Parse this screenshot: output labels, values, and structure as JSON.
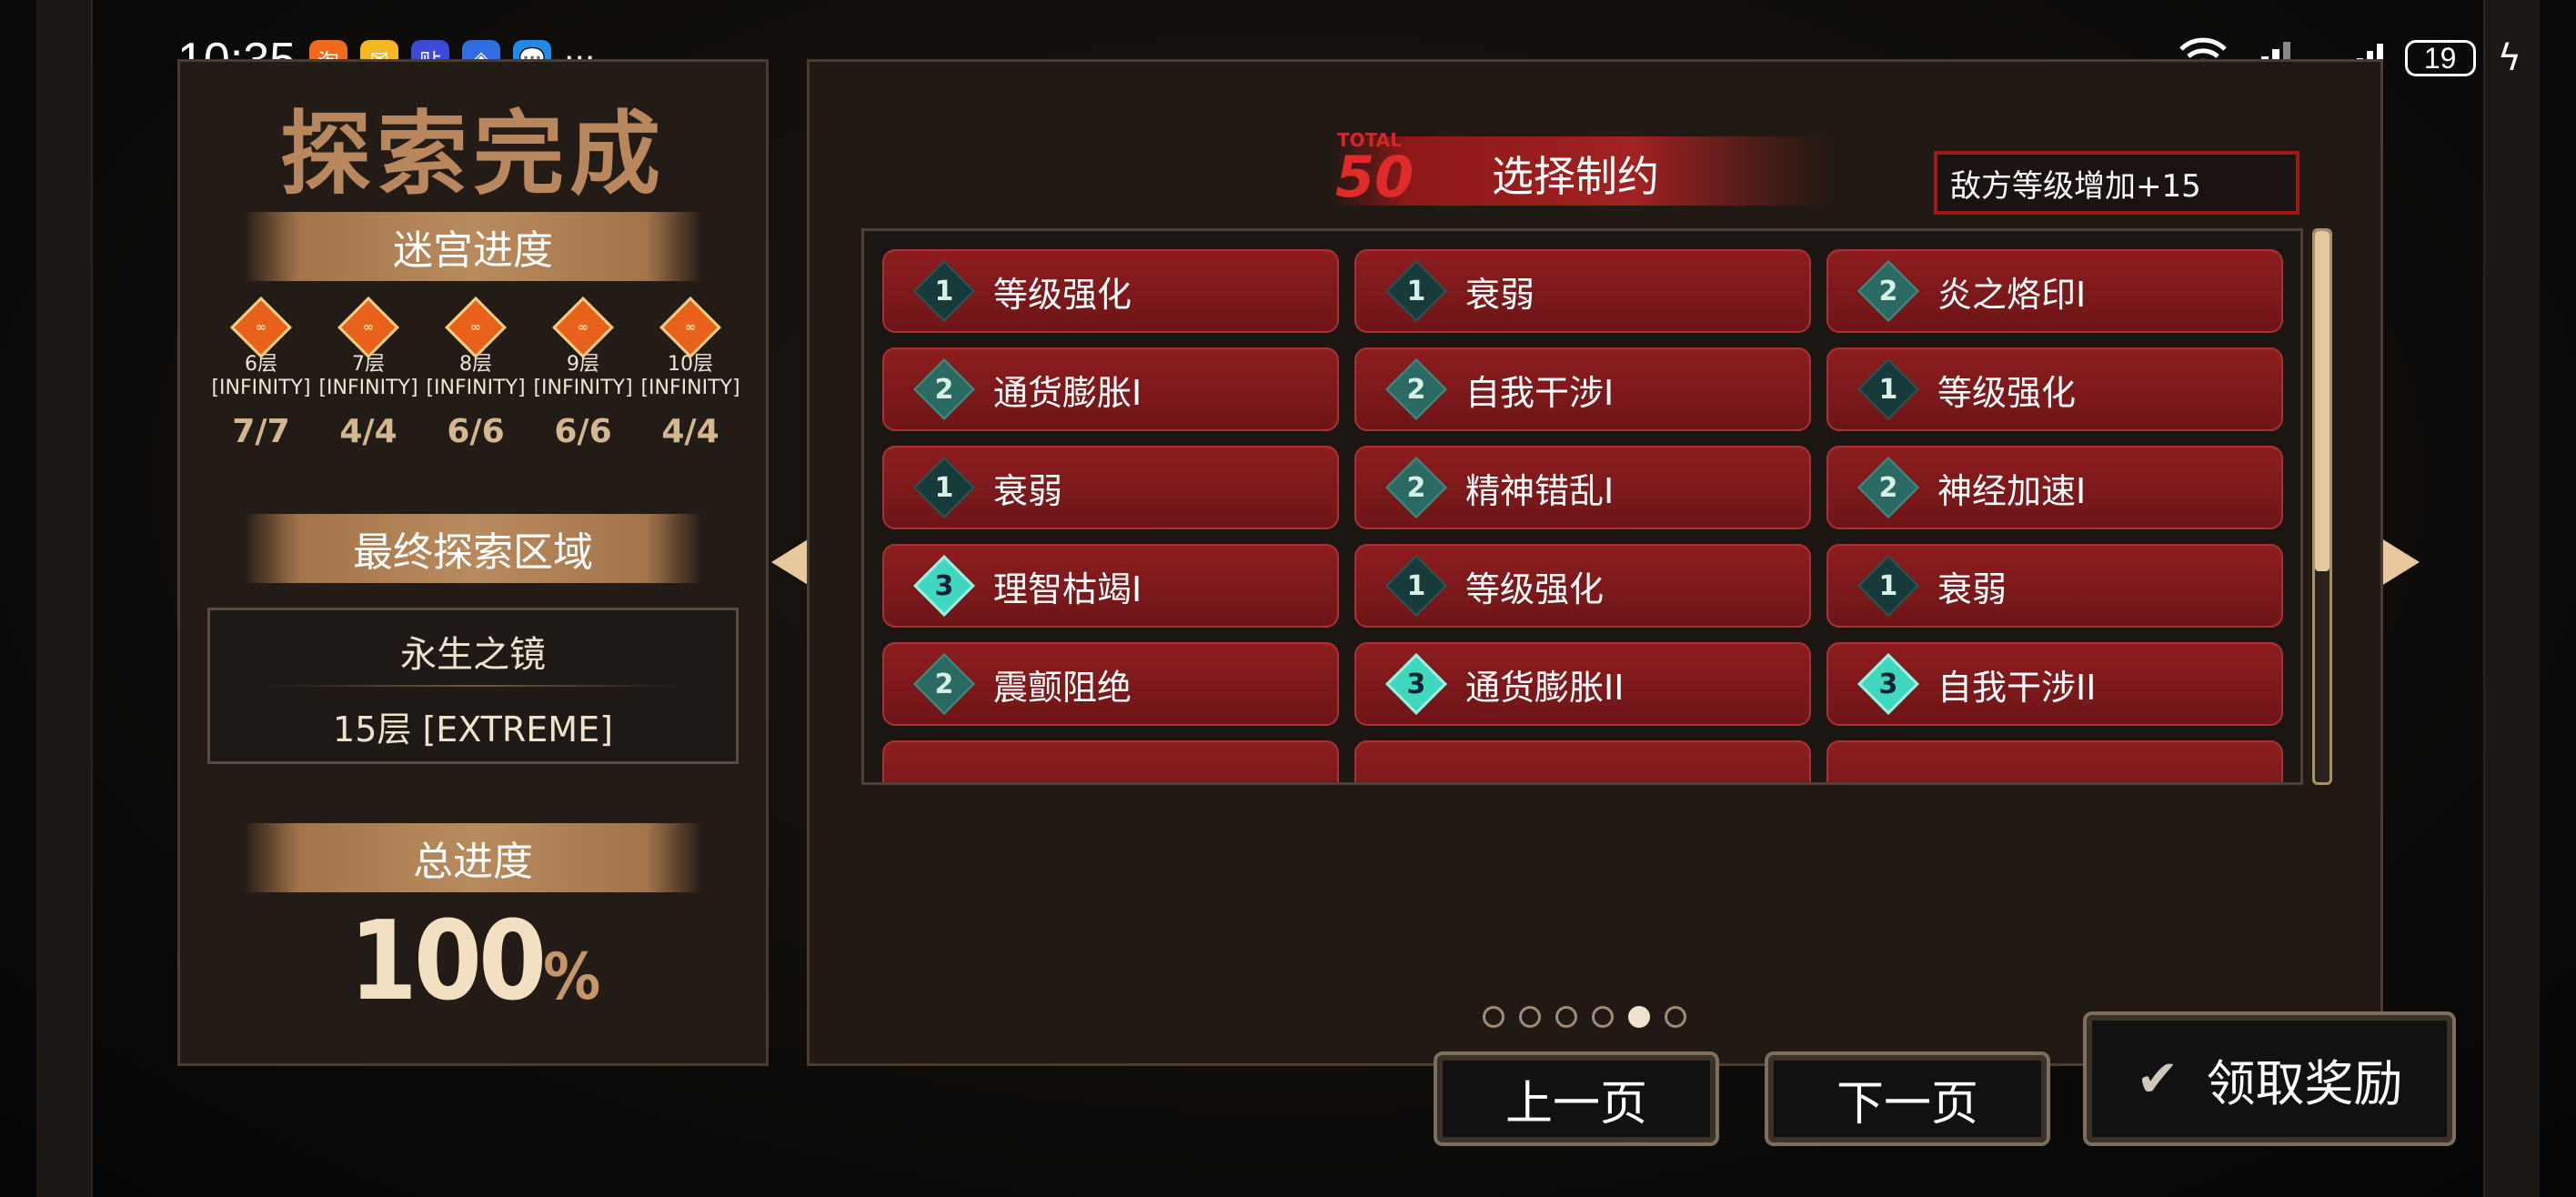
{
  "status_bar": {
    "time": "10:35",
    "apps": [
      {
        "icon": "taobao-icon",
        "color": "#f06a1c",
        "glyph": "淘"
      },
      {
        "icon": "mail-icon",
        "color": "#f5b823",
        "glyph": "✉"
      },
      {
        "icon": "tieba-icon",
        "color": "#3b4bd8",
        "glyph": "贴"
      },
      {
        "icon": "app-icon",
        "color": "#2f6de0",
        "glyph": "◈"
      },
      {
        "icon": "message-icon",
        "color": "#1f8be8",
        "glyph": "💬"
      }
    ],
    "more": "···",
    "network": "4G",
    "battery": "19"
  },
  "left": {
    "title": "探索完成",
    "maze_progress_label": "迷宫进度",
    "floors": [
      {
        "name": "6层",
        "difficulty": "[INFINITY]",
        "count": "7/7"
      },
      {
        "name": "7层",
        "difficulty": "[INFINITY]",
        "count": "4/4"
      },
      {
        "name": "8层",
        "difficulty": "[INFINITY]",
        "count": "6/6"
      },
      {
        "name": "9层",
        "difficulty": "[INFINITY]",
        "count": "6/6"
      },
      {
        "name": "10层",
        "difficulty": "[INFINITY]",
        "count": "4/4"
      }
    ],
    "final_area_label": "最终探索区域",
    "final_area_name": "永生之镜",
    "final_area_floor": "15层 [EXTREME]",
    "total_progress_label": "总进度",
    "total_progress_value": "100",
    "total_progress_unit": "%"
  },
  "right": {
    "total_label": "TOTAL",
    "total_value": "50",
    "header_title": "选择制约",
    "enemy_level": "敌方等级增加+15",
    "constraints": [
      {
        "level": "1",
        "label": "等级强化"
      },
      {
        "level": "1",
        "label": "衰弱"
      },
      {
        "level": "2",
        "label": "炎之烙印I"
      },
      {
        "level": "2",
        "label": "通货膨胀I"
      },
      {
        "level": "2",
        "label": "自我干涉I"
      },
      {
        "level": "1",
        "label": "等级强化"
      },
      {
        "level": "1",
        "label": "衰弱"
      },
      {
        "level": "2",
        "label": "精神错乱I"
      },
      {
        "level": "2",
        "label": "神经加速I"
      },
      {
        "level": "3",
        "label": "理智枯竭I"
      },
      {
        "level": "1",
        "label": "等级强化"
      },
      {
        "level": "1",
        "label": "衰弱"
      },
      {
        "level": "2",
        "label": "震颤阻绝"
      },
      {
        "level": "3",
        "label": "通货膨胀II"
      },
      {
        "level": "3",
        "label": "自我干涉II"
      }
    ],
    "page_count": 6,
    "current_page": 5
  },
  "buttons": {
    "prev": "上一页",
    "next": "下一页",
    "claim": "领取奖励"
  }
}
